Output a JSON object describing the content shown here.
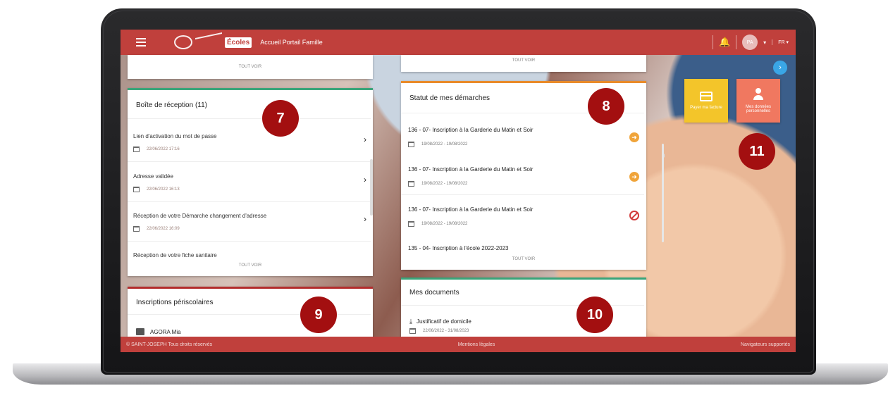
{
  "header": {
    "app_title": "Accueil Portail Famille",
    "logo_text": "Écoles",
    "avatar_initials": "PA",
    "language": "FR"
  },
  "inbox": {
    "top_see_all": "TOUT VOIR",
    "title": "Boîte de réception  (11)",
    "items": [
      {
        "title": "Lien d'activation du mot de passe",
        "date": "22/06/2022 17:16"
      },
      {
        "title": "Adresse validée",
        "date": "22/06/2022 16:13"
      },
      {
        "title": "Réception de votre Démarche changement d'adresse",
        "date": "22/06/2022 16:09"
      },
      {
        "title": "Réception de votre fiche sanitaire",
        "date": ""
      }
    ],
    "see_all": "TOUT VOIR"
  },
  "status": {
    "top_see_all": "TOUT VOIR",
    "title": "Statut de mes démarches",
    "items": [
      {
        "title": "136 - 07- Inscription à la Garderie du Matin et Soir",
        "date": "19/08/2022 - 19/08/2022",
        "icon": "arrow-right-icon"
      },
      {
        "title": "136 - 07- Inscription à la Garderie du Matin et Soir",
        "date": "19/08/2022 - 19/08/2022",
        "icon": "arrow-right-icon"
      },
      {
        "title": "136 - 07- Inscription à la Garderie du Matin et Soir",
        "date": "19/08/2022 - 19/08/2022",
        "icon": "ban-icon"
      },
      {
        "title": "135 - 04- Inscription à l'école 2022-2023",
        "date": ""
      }
    ],
    "see_all": "TOUT VOIR"
  },
  "periscolaire": {
    "title": "Inscriptions périscolaires",
    "item": "AGORA Mia"
  },
  "documents": {
    "title": "Mes documents",
    "item_title": "Justificatif de domicile",
    "item_date": "22/06/2022 - 31/08/2023"
  },
  "tiles": {
    "pay": "Payer ma facture",
    "personal_line1": "Mes données",
    "personal_line2": "personnelles"
  },
  "badges": [
    "7",
    "8",
    "9",
    "10",
    "11"
  ],
  "footer": {
    "copyright": "© SAINT-JOSEPH Tous droits réservés",
    "legal": "Mentions légales",
    "browsers": "Navigateurs supportés"
  },
  "colors": {
    "brand_red": "#c0403c",
    "badge_red": "#a30f10",
    "tile_yellow": "#f3c52a",
    "tile_orange": "#f07860",
    "accent_green": "#3aa57a"
  }
}
